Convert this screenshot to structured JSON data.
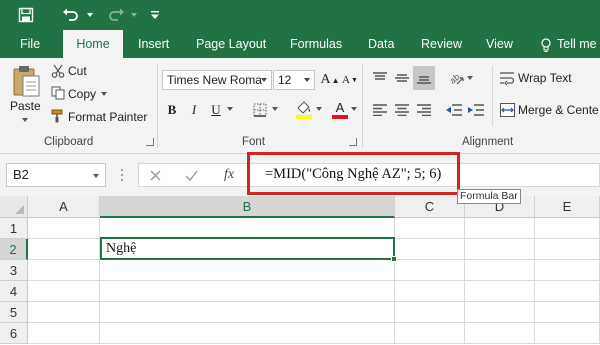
{
  "titlebar": {
    "icons": [
      "save-icon",
      "undo-icon",
      "redo-icon",
      "customize-quick-access-icon"
    ]
  },
  "tabs": [
    "File",
    "Home",
    "Insert",
    "Page Layout",
    "Formulas",
    "Data",
    "Review",
    "View"
  ],
  "active_tab": "Home",
  "tell_me": "Tell me",
  "clipboard": {
    "paste": "Paste",
    "cut": "Cut",
    "copy": "Copy",
    "format_painter": "Format Painter",
    "label": "Clipboard"
  },
  "font": {
    "family": "Times New Roma",
    "size": "12",
    "bold": "B",
    "italic": "I",
    "underline": "U",
    "grow": "A",
    "shrink": "A",
    "font_color_letter": "A",
    "font_color": "#e81123",
    "highlight_color": "#ffff00",
    "label": "Font"
  },
  "alignment": {
    "wrap_text": "Wrap Text",
    "merge_center": "Merge & Cente",
    "label": "Alignment"
  },
  "formula_bar": {
    "name_box": "B2",
    "fx": "fx",
    "formula": "=MID(\"Công Nghệ AZ\"; 5; 6)",
    "tooltip": "Formula Bar"
  },
  "sheet": {
    "columns": [
      "A",
      "B",
      "C",
      "D",
      "E"
    ],
    "rows": [
      "1",
      "2",
      "3",
      "4",
      "5",
      "6"
    ],
    "active_cell": "B2",
    "b2_value": "Nghệ"
  },
  "colors": {
    "excel_green": "#217346",
    "highlight_border": "#d32424"
  }
}
